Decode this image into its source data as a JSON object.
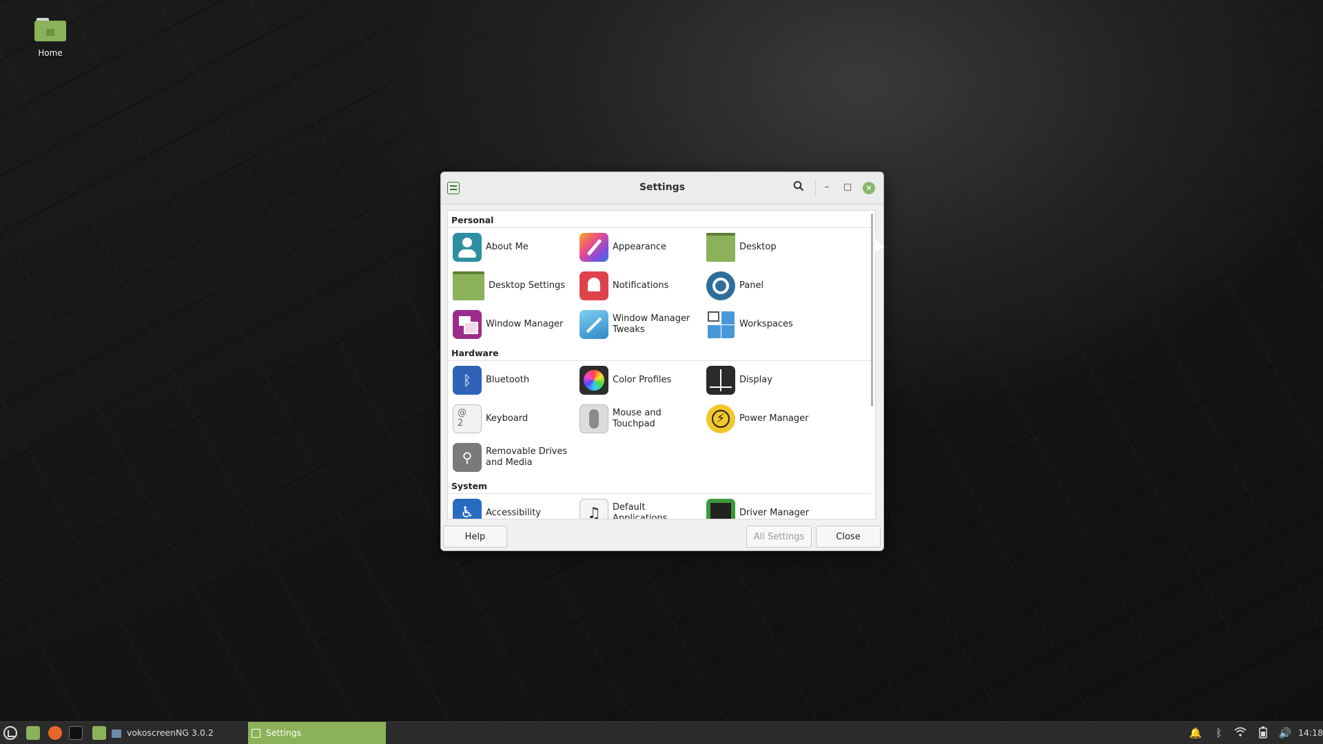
{
  "desktop": {
    "icons": [
      {
        "label": "Home",
        "icon": "folder-home-icon"
      }
    ]
  },
  "window": {
    "title": "Settings",
    "controls": {
      "search": "search-icon",
      "minimize": "–",
      "maximize": "□",
      "close": "×"
    },
    "sections": [
      {
        "title": "Personal",
        "items": [
          {
            "label": "About Me",
            "icon": "user-icon"
          },
          {
            "label": "Appearance",
            "icon": "brush-icon"
          },
          {
            "label": "Desktop",
            "icon": "desktop-icon"
          },
          {
            "label": "Desktop Settings",
            "icon": "desktop-settings-icon"
          },
          {
            "label": "Notifications",
            "icon": "bell-icon"
          },
          {
            "label": "Panel",
            "icon": "panel-icon"
          },
          {
            "label": "Window Manager",
            "icon": "window-manager-icon"
          },
          {
            "label": "Window Manager Tweaks",
            "icon": "wand-icon"
          },
          {
            "label": "Workspaces",
            "icon": "workspaces-icon"
          }
        ]
      },
      {
        "title": "Hardware",
        "items": [
          {
            "label": "Bluetooth",
            "icon": "bluetooth-icon"
          },
          {
            "label": "Color Profiles",
            "icon": "color-wheel-icon"
          },
          {
            "label": "Display",
            "icon": "display-icon"
          },
          {
            "label": "Keyboard",
            "icon": "keyboard-icon"
          },
          {
            "label": "Mouse and Touchpad",
            "icon": "mouse-icon"
          },
          {
            "label": "Power Manager",
            "icon": "power-icon"
          },
          {
            "label": "Removable Drives and Media",
            "icon": "usb-icon"
          }
        ]
      },
      {
        "title": "System",
        "items": [
          {
            "label": "Accessibility",
            "icon": "accessibility-icon"
          },
          {
            "label": "Default Applications",
            "icon": "music-note-icon"
          },
          {
            "label": "Driver Manager",
            "icon": "chip-icon"
          }
        ]
      }
    ],
    "buttons": {
      "help": "Help",
      "all_settings": "All Settings",
      "close": "Close"
    }
  },
  "taskbar": {
    "tasks": [
      {
        "label": "vokoscreenNG 3.0.2",
        "active": false
      },
      {
        "label": "Settings",
        "active": true
      }
    ],
    "clock": "14:18",
    "colors": {
      "accent": "#8bb25a",
      "bar": "#2b2b2b"
    }
  }
}
